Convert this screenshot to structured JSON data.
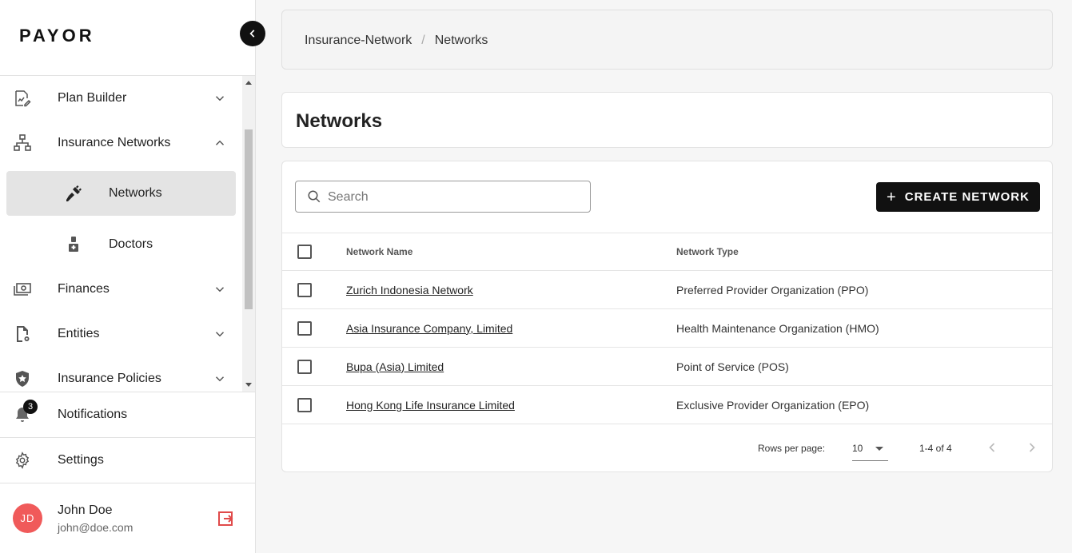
{
  "app": {
    "logo": "PAYOR"
  },
  "sidebar": {
    "items": [
      {
        "label": "Plan Builder",
        "icon": "plan-builder-icon",
        "expanded": false
      },
      {
        "label": "Insurance Networks",
        "icon": "network-icon",
        "expanded": true,
        "children": [
          {
            "label": "Networks",
            "icon": "plug-icon",
            "active": true
          },
          {
            "label": "Doctors",
            "icon": "doctor-icon",
            "active": false
          }
        ]
      },
      {
        "label": "Finances",
        "icon": "money-icon",
        "expanded": false
      },
      {
        "label": "Entities",
        "icon": "entity-file-icon",
        "expanded": false
      },
      {
        "label": "Insurance Policies",
        "icon": "shield-star-icon",
        "expanded": false
      }
    ],
    "notifications": {
      "label": "Notifications",
      "count": "3"
    },
    "settings": {
      "label": "Settings"
    },
    "user": {
      "initials": "JD",
      "name": "John Doe",
      "email": "john@doe.com"
    }
  },
  "breadcrumb": [
    "Insurance-Network",
    "Networks"
  ],
  "page": {
    "title": "Networks"
  },
  "toolbar": {
    "search_placeholder": "Search",
    "create_label": "CREATE NETWORK"
  },
  "table": {
    "columns": [
      "Network Name",
      "Network Type"
    ],
    "rows": [
      {
        "name": "Zurich Indonesia Network",
        "type": "Preferred Provider Organization (PPO)"
      },
      {
        "name": "Asia Insurance Company, Limited",
        "type": "Health Maintenance Organization (HMO)"
      },
      {
        "name": "Bupa (Asia) Limited",
        "type": "Point of Service (POS)"
      },
      {
        "name": "Hong Kong Life Insurance Limited",
        "type": "Exclusive Provider Organization (EPO)"
      }
    ]
  },
  "pagination": {
    "rows_per_page_label": "Rows per page:",
    "rows_per_page": "10",
    "range": "1-4 of 4"
  },
  "colors": {
    "accent": "#111111",
    "avatar": "#f05a5a",
    "logout": "#e04a4a",
    "active_bg": "#e4e4e4"
  }
}
